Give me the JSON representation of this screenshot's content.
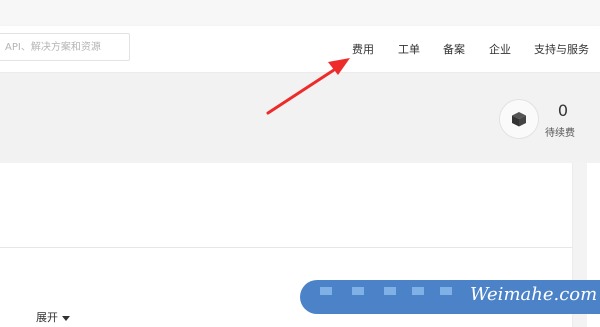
{
  "search": {
    "placeholder": "API、解决方案和资源"
  },
  "nav": {
    "items": [
      {
        "label": "费用"
      },
      {
        "label": "工单"
      },
      {
        "label": "备案"
      },
      {
        "label": "企业"
      },
      {
        "label": "支持与服务"
      }
    ]
  },
  "billing": {
    "count": "0",
    "label": "待续费",
    "icon": "box-icon"
  },
  "section": {
    "expand_label": "展开"
  },
  "watermark": {
    "text": "Weimahe.com"
  },
  "colors": {
    "arrow": "#ee2b2b",
    "watermark_bg": "#4b82c8",
    "banner_bg": "#f2f2f2"
  }
}
